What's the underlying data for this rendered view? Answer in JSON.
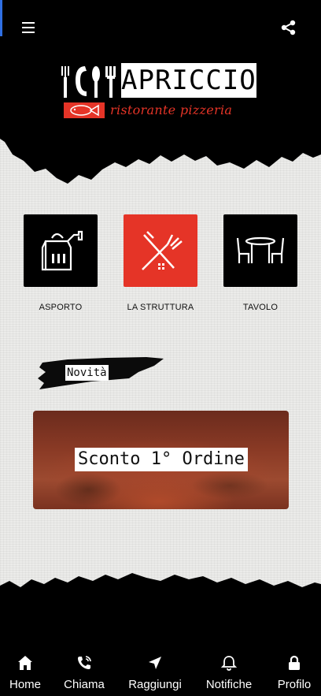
{
  "header": {
    "menu_icon": "hamburger-menu-icon",
    "share_icon": "share-icon"
  },
  "logo": {
    "word": "APRICCIO",
    "subtitle": "ristorante pizzeria",
    "brand_color": "#e53427"
  },
  "tiles": [
    {
      "label": "ASPORTO",
      "icon": "takeaway-bag-icon",
      "bg": "#000000"
    },
    {
      "label": "LA STRUTTURA",
      "icon": "fork-knife-crossed-icon",
      "bg": "#e53427"
    },
    {
      "label": "TAVOLO",
      "icon": "table-chairs-icon",
      "bg": "#000000"
    }
  ],
  "news": {
    "heading": "Novità"
  },
  "banner": {
    "text": "Sconto 1° Ordine"
  },
  "bottom_nav": [
    {
      "label": "Home",
      "icon": "home-icon"
    },
    {
      "label": "Chiama",
      "icon": "phone-call-icon"
    },
    {
      "label": "Raggiungi",
      "icon": "navigation-arrow-icon"
    },
    {
      "label": "Notifiche",
      "icon": "bell-icon"
    },
    {
      "label": "Profilo",
      "icon": "lock-icon"
    }
  ]
}
